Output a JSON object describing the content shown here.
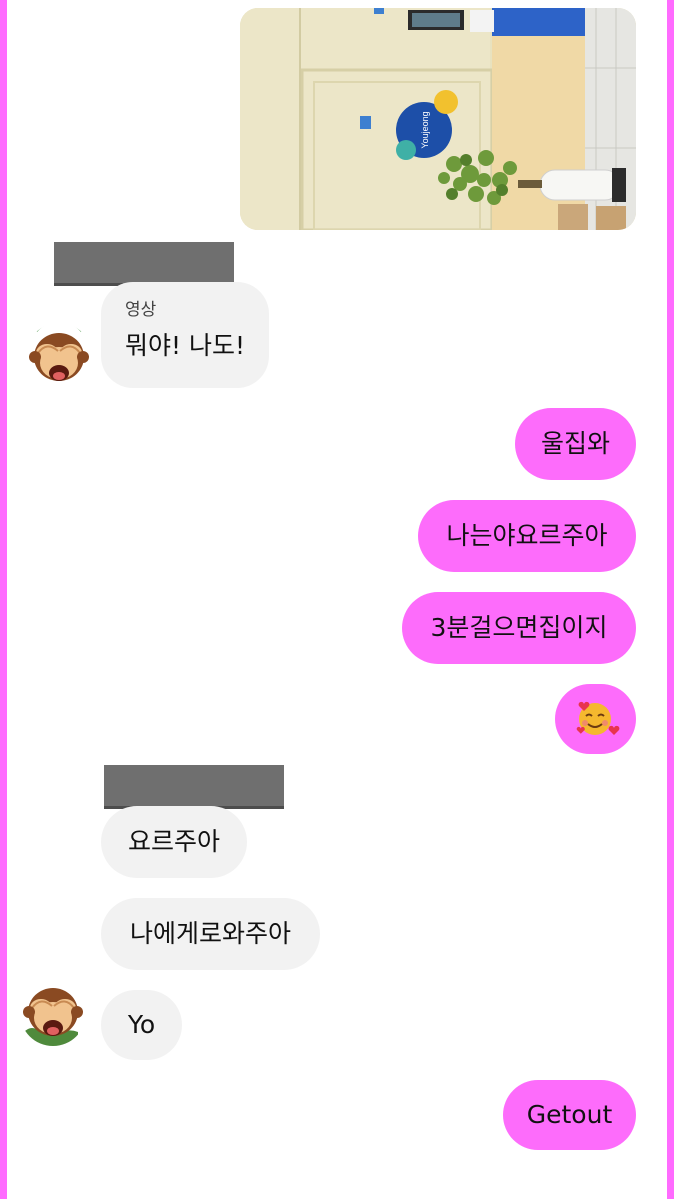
{
  "frame": {
    "accent": "#ff6bff"
  },
  "photo": {
    "logo_text": "Youjeong"
  },
  "messages": [
    {
      "side": "in",
      "caption": "영상",
      "text": "뭐야! 나도!"
    },
    {
      "side": "out",
      "text": "울집와"
    },
    {
      "side": "out",
      "text": "나는야요르주아"
    },
    {
      "side": "out",
      "text": "3분걸으면집이지"
    },
    {
      "side": "out",
      "text": "🥰"
    },
    {
      "side": "in",
      "text": "요르주아"
    },
    {
      "side": "in",
      "text": "나에게로와주아"
    },
    {
      "side": "in",
      "text": "Yo"
    },
    {
      "side": "out",
      "text": "Getout"
    }
  ],
  "avatar": {
    "icon": "see-no-evil-monkey-icon"
  },
  "colors": {
    "outgoing_bubble": "#fd6cfb",
    "incoming_bubble": "#f2f2f2",
    "redaction": "#6f6f6f"
  }
}
